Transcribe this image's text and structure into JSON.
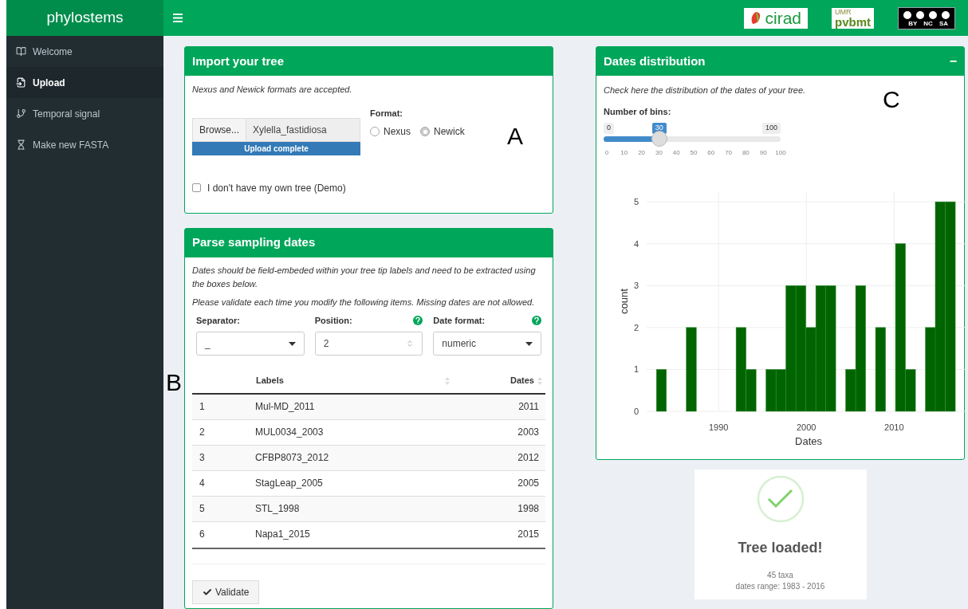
{
  "header": {
    "brand": "phylostems",
    "logos": [
      {
        "kind": "cirad",
        "text": "cirad"
      },
      {
        "kind": "pvbmt",
        "top": "UMR",
        "text": "pvbmt"
      },
      {
        "kind": "cc",
        "parts": [
          "BY",
          "NC",
          "SA"
        ]
      }
    ]
  },
  "sidebar": {
    "items": [
      {
        "label": "Welcome",
        "selected": false
      },
      {
        "label": "Upload",
        "selected": true
      },
      {
        "label": "Temporal signal",
        "selected": false
      },
      {
        "label": "Make new FASTA",
        "selected": false
      }
    ]
  },
  "import_box": {
    "title": "Import your tree",
    "note": "Nexus and Newick formats are accepted.",
    "browse": "Browse...",
    "file": "Xylella_fastidiosa",
    "progress": {
      "label": "Upload complete",
      "level": 1
    },
    "format_label": "Format:",
    "formats": [
      {
        "label": "Nexus",
        "selected": false
      },
      {
        "label": "Newick",
        "selected": true
      }
    ],
    "demo": {
      "label": "I don't have my own tree (Demo)",
      "checked": false
    }
  },
  "parse_box": {
    "title": "Parse sampling dates",
    "notes": [
      "Dates should be field-embeded within your tree tip labels and need to be extracted using the boxes below.",
      "Please validate each time you modify the following items. Missing dates are not allowed."
    ],
    "fields": [
      {
        "kind": "select",
        "label": "Separator:",
        "value": "_",
        "help": false
      },
      {
        "kind": "number",
        "label": "Position:",
        "value": "2",
        "help": true
      },
      {
        "kind": "select",
        "label": "Date format:",
        "value": "numeric",
        "help": true
      }
    ],
    "table": {
      "columns": [
        "",
        "Labels",
        "Dates"
      ],
      "rows": [
        [
          "1",
          "Mul-MD_2011",
          "2011"
        ],
        [
          "2",
          "MUL0034_2003",
          "2003"
        ],
        [
          "3",
          "CFBP8073_2012",
          "2012"
        ],
        [
          "4",
          "StagLeap_2005",
          "2005"
        ],
        [
          "5",
          "STL_1998",
          "1998"
        ],
        [
          "6",
          "Napa1_2015",
          "2015"
        ]
      ]
    },
    "validate": "Validate"
  },
  "dates_box": {
    "title": "Dates distribution",
    "collapse": "−",
    "note": "Check here the distribution of the dates of your tree.",
    "slider": {
      "label": "Number of bins:",
      "min": "0",
      "max": "100",
      "value": "30",
      "level": 0.3,
      "ticks": [
        "0",
        "10",
        "20",
        "30",
        "40",
        "50",
        "60",
        "70",
        "80",
        "90",
        "100"
      ]
    },
    "chart_data": {
      "type": "bar",
      "xlabel": "Dates",
      "ylabel": "count",
      "x": [
        1983.48,
        1984.62,
        1985.75,
        1986.89,
        1988.02,
        1989.16,
        1990.29,
        1991.43,
        1992.56,
        1993.7,
        1994.84,
        1995.97,
        1997.11,
        1998.24,
        1999.38,
        2000.51,
        2001.65,
        2002.78,
        2003.92,
        2005.05,
        2006.19,
        2007.33,
        2008.46,
        2009.6,
        2010.73,
        2011.87,
        2013.0,
        2014.14,
        2015.27,
        2016.41
      ],
      "grid": true,
      "series": [
        {
          "color": "#006400",
          "values": [
            1,
            0,
            0,
            2,
            0,
            0,
            0,
            0,
            2,
            1,
            0,
            1,
            1,
            3,
            3,
            2,
            3,
            3,
            0,
            1,
            3,
            0,
            2,
            0,
            4,
            1,
            0,
            2,
            5,
            5
          ]
        }
      ],
      "xlim": [
        1981.8,
        2018.7
      ],
      "ylim": [
        0,
        5.25
      ],
      "xticks": [
        1990,
        2000,
        2010
      ],
      "yticks": [
        0,
        1,
        2,
        3,
        4,
        5
      ]
    }
  },
  "status_card": {
    "title": "Tree loaded!",
    "lines": [
      "45 taxa",
      "dates range: 1983 - 2016"
    ]
  },
  "annotations": [
    {
      "kind": "A",
      "text": "A"
    },
    {
      "kind": "B",
      "text": "B"
    },
    {
      "kind": "C",
      "text": "C"
    }
  ]
}
